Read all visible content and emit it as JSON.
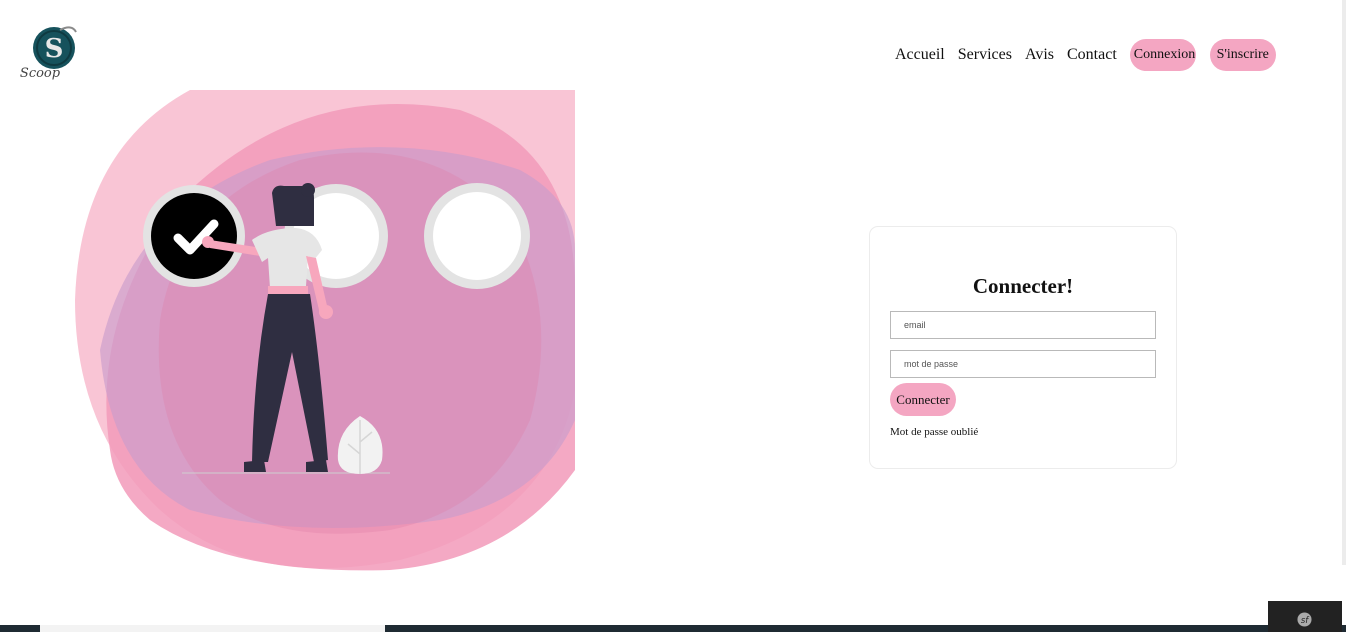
{
  "brand": {
    "name": "Scoop",
    "primary_color": "#16525c",
    "accent_color": "#f4a6c2"
  },
  "nav": {
    "links": [
      "Accueil",
      "Services",
      "Avis",
      "Contact"
    ],
    "connexion_label": "Connexion",
    "inscrire_label": "S'inscrire"
  },
  "login": {
    "title": "Connecter!",
    "email_placeholder": "email",
    "password_placeholder": "mot de passe",
    "submit_label": "Connecter",
    "forgot_label": "Mot de passe oublié"
  },
  "illustration": {
    "icon": "checklist-woman-illustration",
    "checked_count": 1,
    "total_count": 3
  },
  "debug_toolbar": {
    "icon": "symfony-icon"
  }
}
